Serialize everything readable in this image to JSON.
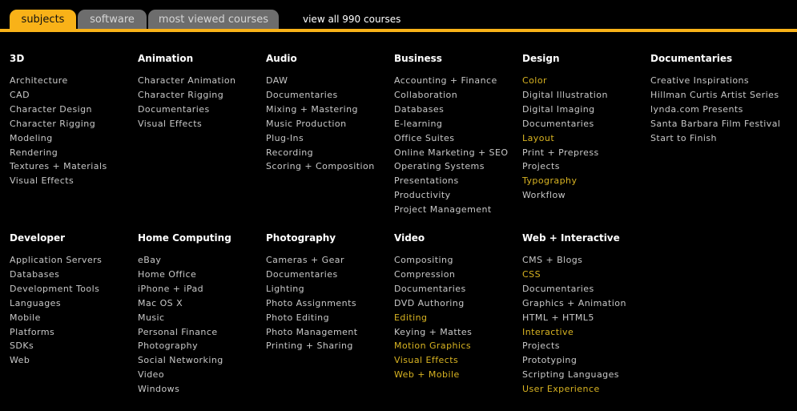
{
  "tabs": [
    {
      "label": "subjects"
    },
    {
      "label": "software"
    },
    {
      "label": "most viewed courses"
    }
  ],
  "view_all": "view all 990 courses",
  "colors": {
    "accent": "#f9b218",
    "highlight_link": "#d9b422",
    "tab_inactive": "#6d6d6d"
  },
  "categories": [
    {
      "title": "3D",
      "items": [
        "Architecture",
        "CAD",
        "Character Design",
        "Character Rigging",
        "Modeling",
        "Rendering",
        "Textures + Materials",
        "Visual Effects"
      ]
    },
    {
      "title": "Animation",
      "items": [
        "Character Animation",
        "Character Rigging",
        "Documentaries",
        "Visual Effects"
      ]
    },
    {
      "title": "Audio",
      "items": [
        "DAW",
        "Documentaries",
        "Mixing + Mastering",
        "Music Production",
        "Plug-Ins",
        "Recording",
        "Scoring + Composition"
      ]
    },
    {
      "title": "Business",
      "items": [
        "Accounting + Finance",
        "Collaboration",
        "Databases",
        "E-learning",
        "Office Suites",
        "Online Marketing + SEO",
        "Operating Systems",
        "Presentations",
        "Productivity",
        "Project Management"
      ]
    },
    {
      "title": "Design",
      "items": [
        "Color",
        "Digital Illustration",
        "Digital Imaging",
        "Documentaries",
        "Layout",
        "Print + Prepress",
        "Projects",
        "Typography",
        "Workflow"
      ],
      "highlighted": [
        0,
        4,
        7
      ]
    },
    {
      "title": "Documentaries",
      "items": [
        "Creative Inspirations",
        "Hillman Curtis Artist Series",
        "lynda.com Presents",
        "Santa Barbara Film Festival",
        "Start to Finish"
      ]
    },
    {
      "title": "Developer",
      "items": [
        "Application Servers",
        "Databases",
        "Development Tools",
        "Languages",
        "Mobile",
        "Platforms",
        "SDKs",
        "Web"
      ]
    },
    {
      "title": "Home Computing",
      "items": [
        "eBay",
        "Home Office",
        "iPhone + iPad",
        "Mac OS X",
        "Music",
        "Personal Finance",
        "Photography",
        "Social Networking",
        "Video",
        "Windows"
      ]
    },
    {
      "title": "Photography",
      "items": [
        "Cameras + Gear",
        "Documentaries",
        "Lighting",
        "Photo Assignments",
        "Photo Editing",
        "Photo Management",
        "Printing + Sharing"
      ]
    },
    {
      "title": "Video",
      "items": [
        "Compositing",
        "Compression",
        "Documentaries",
        "DVD Authoring",
        "Editing",
        "Keying + Mattes",
        "Motion Graphics",
        "Visual Effects",
        "Web + Mobile"
      ],
      "highlighted": [
        4,
        6,
        7,
        8
      ]
    },
    {
      "title": "Web + Interactive",
      "items": [
        "CMS + Blogs",
        "CSS",
        "Documentaries",
        "Graphics + Animation",
        "HTML + HTML5",
        "Interactive",
        "Projects",
        "Prototyping",
        "Scripting Languages",
        "User Experience"
      ],
      "highlighted": [
        1,
        5,
        9
      ]
    }
  ]
}
